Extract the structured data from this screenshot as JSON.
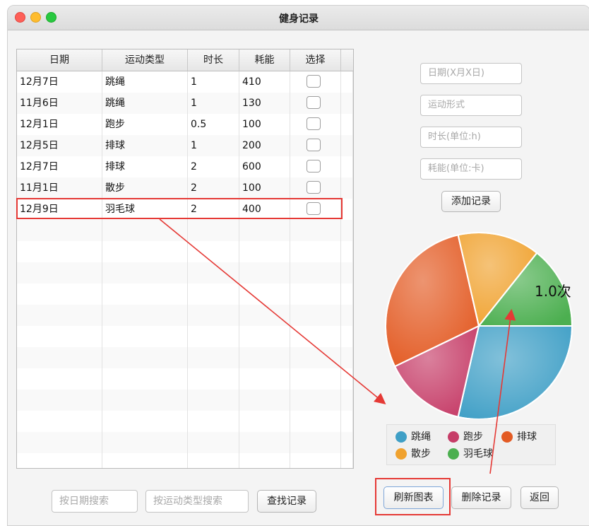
{
  "window": {
    "title": "健身记录"
  },
  "table": {
    "headers": [
      "日期",
      "运动类型",
      "时长",
      "耗能",
      "选择"
    ],
    "rows": [
      {
        "date": "12月7日",
        "type": "跳绳",
        "duration": "1",
        "energy": "410"
      },
      {
        "date": "11月6日",
        "type": "跳绳",
        "duration": "1",
        "energy": "130"
      },
      {
        "date": "12月1日",
        "type": "跑步",
        "duration": "0.5",
        "energy": "100"
      },
      {
        "date": "12月5日",
        "type": "排球",
        "duration": "1",
        "energy": "200"
      },
      {
        "date": "12月7日",
        "type": "排球",
        "duration": "2",
        "energy": "600"
      },
      {
        "date": "11月1日",
        "type": "散步",
        "duration": "2",
        "energy": "100"
      },
      {
        "date": "12月9日",
        "type": "羽毛球",
        "duration": "2",
        "energy": "400"
      }
    ]
  },
  "form": {
    "date_placeholder": "日期(X月X日)",
    "type_placeholder": "运动形式",
    "duration_placeholder": "时长(单位:h)",
    "energy_placeholder": "耗能(单位:卡)",
    "add_label": "添加记录"
  },
  "chart_data": {
    "type": "pie",
    "slice_label": "1.0次",
    "slices": [
      {
        "name": "跳绳",
        "value": 2,
        "color": "#3f9fc6"
      },
      {
        "name": "跑步",
        "value": 1,
        "color": "#c63d68"
      },
      {
        "name": "排球",
        "value": 2,
        "color": "#e35b24"
      },
      {
        "name": "散步",
        "value": 1,
        "color": "#f0a22f"
      },
      {
        "name": "羽毛球",
        "value": 1,
        "color": "#4caf50"
      }
    ],
    "legend": {
      "placement": "bottom"
    }
  },
  "search": {
    "date_placeholder": "按日期搜索",
    "type_placeholder": "按运动类型搜索",
    "find_label": "查找记录"
  },
  "actions": {
    "refresh_label": "刷新图表",
    "delete_label": "删除记录",
    "back_label": "返回"
  }
}
